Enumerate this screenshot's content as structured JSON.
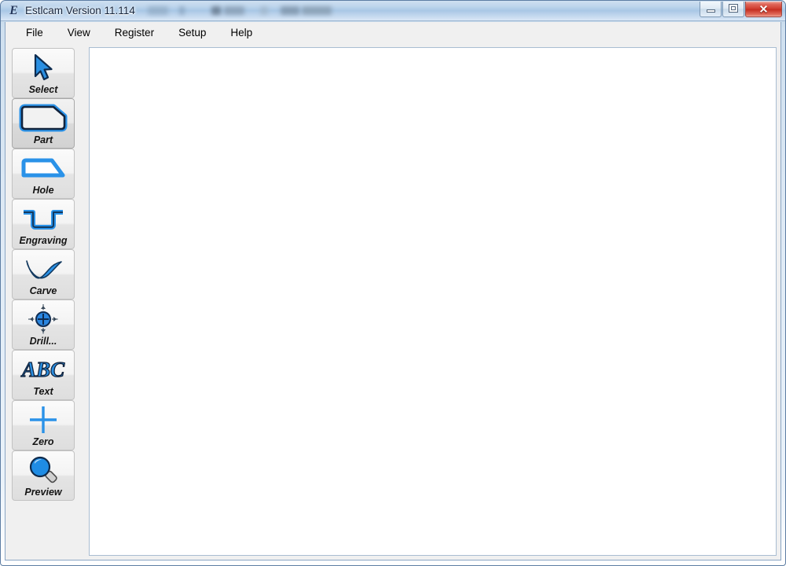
{
  "window": {
    "title": "Estlcam Version 11.114",
    "icon": "estlcam-logo-icon",
    "redacted_title_extra": "",
    "buttons": {
      "minimize": "Minimize",
      "maximize": "Maximize",
      "close": "Close",
      "close_glyph": "✕"
    }
  },
  "menu": {
    "items": [
      {
        "label": "File"
      },
      {
        "label": "View"
      },
      {
        "label": "Register"
      },
      {
        "label": "Setup"
      },
      {
        "label": "Help"
      }
    ]
  },
  "toolbar": {
    "buttons": [
      {
        "label": "Select",
        "icon": "cursor-arrow-icon",
        "selected": false
      },
      {
        "label": "Part",
        "icon": "part-outline-icon",
        "selected": true
      },
      {
        "label": "Hole",
        "icon": "hole-outline-icon",
        "selected": false
      },
      {
        "label": "Engraving",
        "icon": "engraving-channel-icon",
        "selected": false
      },
      {
        "label": "Carve",
        "icon": "carve-wave-icon",
        "selected": false
      },
      {
        "label": "Drill...",
        "icon": "drill-crosshair-icon",
        "selected": false
      },
      {
        "label": "Text",
        "icon": "abc-text-icon",
        "selected": false,
        "glyph": "ABC"
      },
      {
        "label": "Zero",
        "icon": "zero-crosshair-icon",
        "selected": false
      },
      {
        "label": "Preview",
        "icon": "magnifier-preview-icon",
        "selected": false
      }
    ]
  },
  "canvas": {
    "content": "",
    "background_color": "#ffffff"
  },
  "colors": {
    "accent_blue": "#1a8fe0",
    "icon_outline": "#10355e",
    "title_bar_blue": "#a9c8e6",
    "close_red": "#cf3a2c",
    "button_face": "#f0f0f0"
  }
}
